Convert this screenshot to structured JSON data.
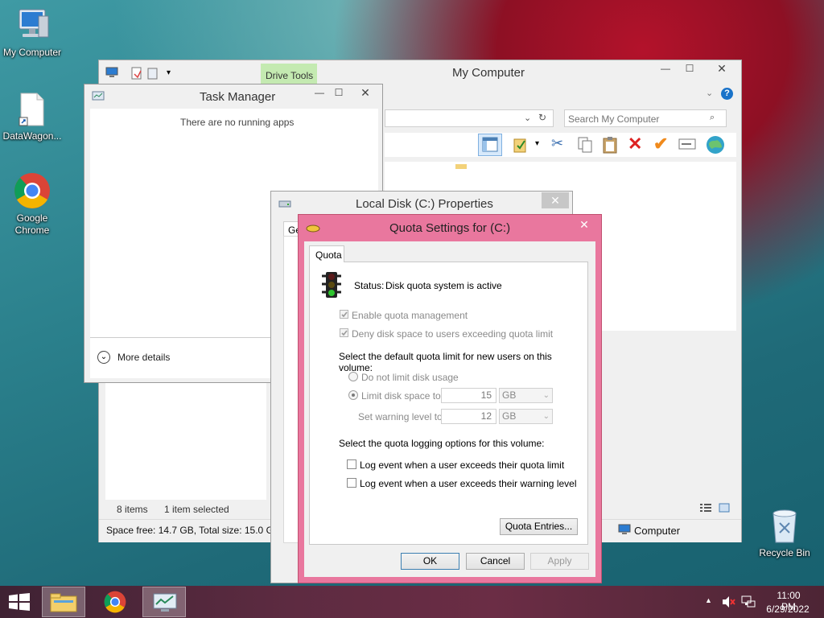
{
  "desktop": {
    "icons": [
      {
        "label": "My Computer"
      },
      {
        "label": "DataWagon..."
      },
      {
        "label": "Google Chrome"
      },
      {
        "label": "Recycle Bin"
      }
    ]
  },
  "my_computer": {
    "title": "My Computer",
    "ribbon_tab": "Drive Tools",
    "search_placeholder": "Search My Computer",
    "status": {
      "items": "8 items",
      "selected": "1 item selected"
    },
    "details": {
      "space": "Space free: 14.7 GB, Total size: 15.0 GB",
      "location": "Computer"
    }
  },
  "task_manager": {
    "title": "Task Manager",
    "empty_message": "There are no running apps",
    "more_details": "More details"
  },
  "properties": {
    "title": "Local Disk (C:) Properties",
    "tab_partial": "Ge"
  },
  "quota": {
    "title": "Quota Settings for  (C:)",
    "tab": "Quota",
    "status_label": "Status:",
    "status_value": "Disk quota system is active",
    "enable_quota": "Enable quota management",
    "deny_space": "Deny disk space to users exceeding quota limit",
    "default_limit_heading": "Select the default quota limit for new users on this volume:",
    "no_limit": "Do not limit disk usage",
    "limit_to": "Limit disk space to",
    "limit_value": "15",
    "limit_unit": "GB",
    "warning_label": "Set warning level to",
    "warning_value": "12",
    "warning_unit": "GB",
    "logging_heading": "Select the quota logging options for this volume:",
    "log_limit": "Log event when a user exceeds their quota limit",
    "log_warning": "Log event when a user exceeds their warning level",
    "quota_entries": "Quota Entries...",
    "ok": "OK",
    "cancel": "Cancel",
    "apply": "Apply"
  },
  "taskbar": {
    "time": "11:00 PM",
    "date": "6/29/2022"
  },
  "colors": {
    "quota_frame": "#e9779e",
    "taskbar": "#5d2b41",
    "accent_blue": "#1a73c9"
  }
}
